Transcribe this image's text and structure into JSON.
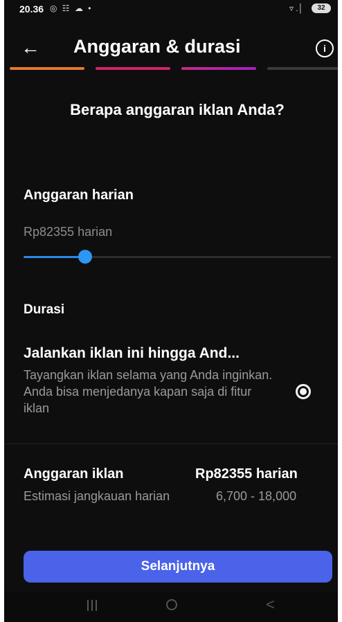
{
  "status_bar": {
    "time": "20.36",
    "left_icons": "◎ ☷ ☁ •",
    "right_icons": "▿ .│",
    "battery": "32"
  },
  "header": {
    "back_icon": "←",
    "title": "Anggaran & durasi",
    "info_icon": "i"
  },
  "progress": {
    "segments_total": 4,
    "segments_completed": 3,
    "colors": [
      "#e37a2f",
      "#d3236d",
      "#c42c86",
      "#a51ec4"
    ]
  },
  "question": "Berapa anggaran iklan Anda?",
  "daily_budget": {
    "label": "Anggaran harian",
    "value_text": "Rp82355 harian",
    "slider_fraction": 0.2
  },
  "duration": {
    "label": "Durasi",
    "option_title": "Jalankan iklan ini hingga And...",
    "option_description": "Tayangkan iklan selama yang Anda inginkan. Anda bisa menjedanya kapan saja di fitur iklan",
    "selected": true
  },
  "summary": {
    "budget_label": "Anggaran iklan",
    "budget_value": "Rp82355 harian",
    "estimate_label": "Estimasi jangkauan harian",
    "estimate_value": "6,700 - 18,000"
  },
  "next_button": "Selanjutnya",
  "nav": {
    "back_glyph": "<"
  },
  "colors": {
    "background": "#0e0e0e",
    "accent_blue": "#2e96f3",
    "button": "#4a63e8"
  }
}
